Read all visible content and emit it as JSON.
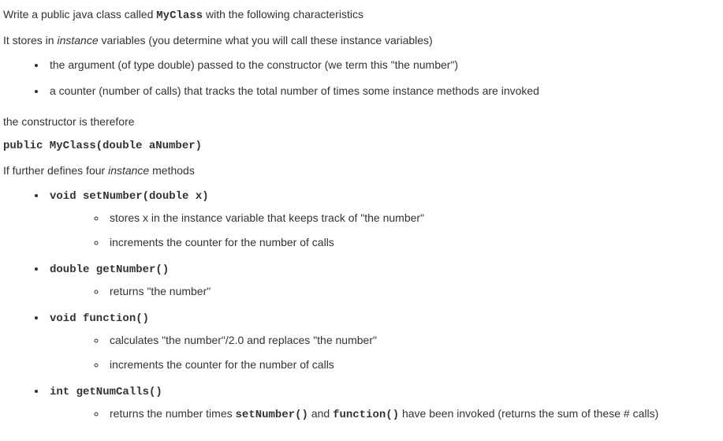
{
  "intro": {
    "line1_pre": "Write a public java class called ",
    "line1_class": "MyClass",
    "line1_post": " with the following characteristics",
    "line2_pre": "It stores in ",
    "line2_em": "instance",
    "line2_post": " variables (you determine what you will call these instance variables)"
  },
  "storage_items": {
    "item1": "the argument (of type double) passed to the constructor (we term this \"the number\")",
    "item2": "a counter (number of calls) that tracks the total number of times some instance methods are invoked"
  },
  "constructor": {
    "lead": "the constructor is therefore",
    "signature": "public MyClass(double aNumber)"
  },
  "methods_intro": {
    "pre": "If further defines four ",
    "em": "instance",
    "post": " methods"
  },
  "methods": {
    "m1": {
      "signature": "void setNumber(double x)",
      "sub1": "stores x in the instance variable that keeps track of \"the number\"",
      "sub2": "increments the counter for the number of calls"
    },
    "m2": {
      "signature": "double getNumber()",
      "sub1": "returns \"the number\""
    },
    "m3": {
      "signature": "void function()",
      "sub1": "calculates \"the number\"/2.0 and replaces \"the number\"",
      "sub2": "increments the counter for the number of calls"
    },
    "m4": {
      "signature": "int getNumCalls()",
      "sub1_pre": "returns the number times ",
      "sub1_code1": "setNumber()",
      "sub1_mid": " and ",
      "sub1_code2": "function()",
      "sub1_post": " have been invoked (returns the sum of these # calls)"
    }
  }
}
